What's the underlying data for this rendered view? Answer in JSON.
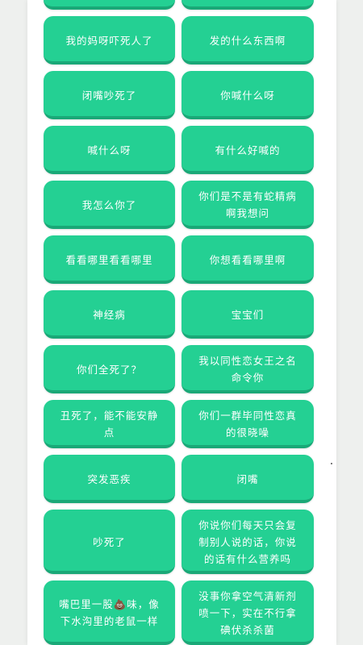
{
  "buttons": [
    "",
    "",
    "我的妈呀吓死人了",
    "发的什么东西啊",
    "闭嘴吵死了",
    "你喊什么呀",
    "喊什么呀",
    "有什么好喊的",
    "我怎么你了",
    "你们是不是有蛇精病啊我想问",
    "看看哪里看看哪里",
    "你想看看哪里啊",
    "神经病",
    "宝宝们",
    "你们全死了？",
    "我以同性恋女王之名命令你",
    "丑死了，能不能安静点",
    "你们一群毕同性恋真的很晓噪",
    "突发恶疾",
    "闭嘴",
    "吵死了",
    "你说你们每天只会复制别人说的话，你说的话有什么营养吗",
    "嘴巴里一股💩味，像下水沟里的老鼠一样",
    "没事你拿空气清新剂喷一下，实在不行拿碘伏杀杀菌"
  ]
}
